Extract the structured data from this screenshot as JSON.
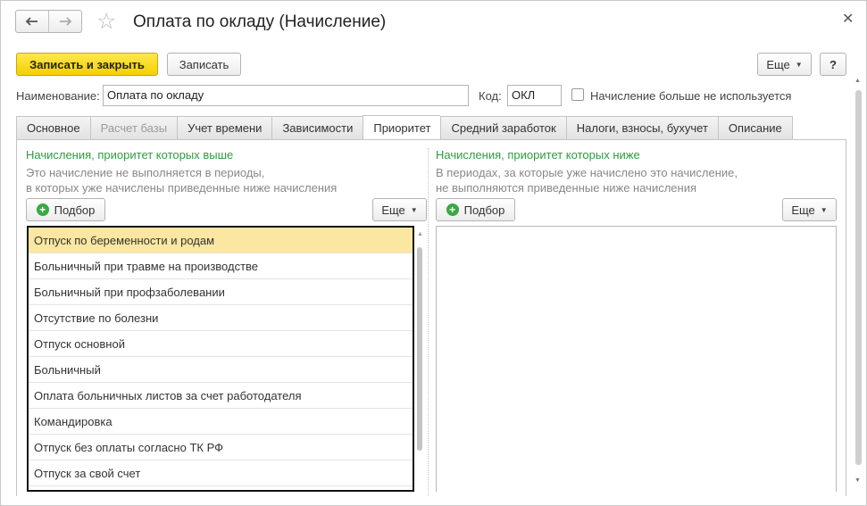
{
  "header": {
    "title": "Оплата по окладу (Начисление)",
    "back_icon": "arrow-left-icon",
    "forward_icon": "arrow-right-icon",
    "favorite_icon": "star-icon",
    "close_icon": "close-icon"
  },
  "toolbar": {
    "save_close_label": "Записать и закрыть",
    "save_label": "Записать",
    "more_label": "Еще",
    "help_label": "?"
  },
  "form": {
    "name_label": "Наименование:",
    "name_value": "Оплата по окладу",
    "code_label": "Код:",
    "code_value": "ОКЛ",
    "unused_checkbox_label": "Начисление больше не используется"
  },
  "tabs": [
    {
      "label": "Основное"
    },
    {
      "label": "Расчет базы"
    },
    {
      "label": "Учет времени"
    },
    {
      "label": "Зависимости"
    },
    {
      "label": "Приоритет"
    },
    {
      "label": "Средний заработок"
    },
    {
      "label": "Налоги, взносы, бухучет"
    },
    {
      "label": "Описание"
    }
  ],
  "left_section": {
    "title": "Начисления, приоритет которых выше",
    "desc_line1": "Это начисление не выполняется в периоды,",
    "desc_line2": "в которых уже начислены приведенные ниже начисления",
    "pick_label": "Подбор",
    "more_label": "Еще",
    "items": [
      "Отпуск по беременности и родам",
      "Больничный при травме на производстве",
      "Больничный при профзаболевании",
      "Отсутствие по болезни",
      "Отпуск основной",
      "Больничный",
      "Оплата больничных листов за счет работодателя",
      "Командировка",
      "Отпуск без оплаты согласно ТК РФ",
      "Отпуск за свой счет"
    ]
  },
  "right_section": {
    "title": "Начисления, приоритет которых ниже",
    "desc_line1": "В периодах, за которые уже начислено это начисление,",
    "desc_line2": "не выполняются приведенные ниже начисления",
    "pick_label": "Подбор",
    "more_label": "Еще"
  },
  "colors": {
    "primary_button": "#f5cf00",
    "section_title": "#2e9c3f",
    "selected_row": "#fbe7a1"
  }
}
